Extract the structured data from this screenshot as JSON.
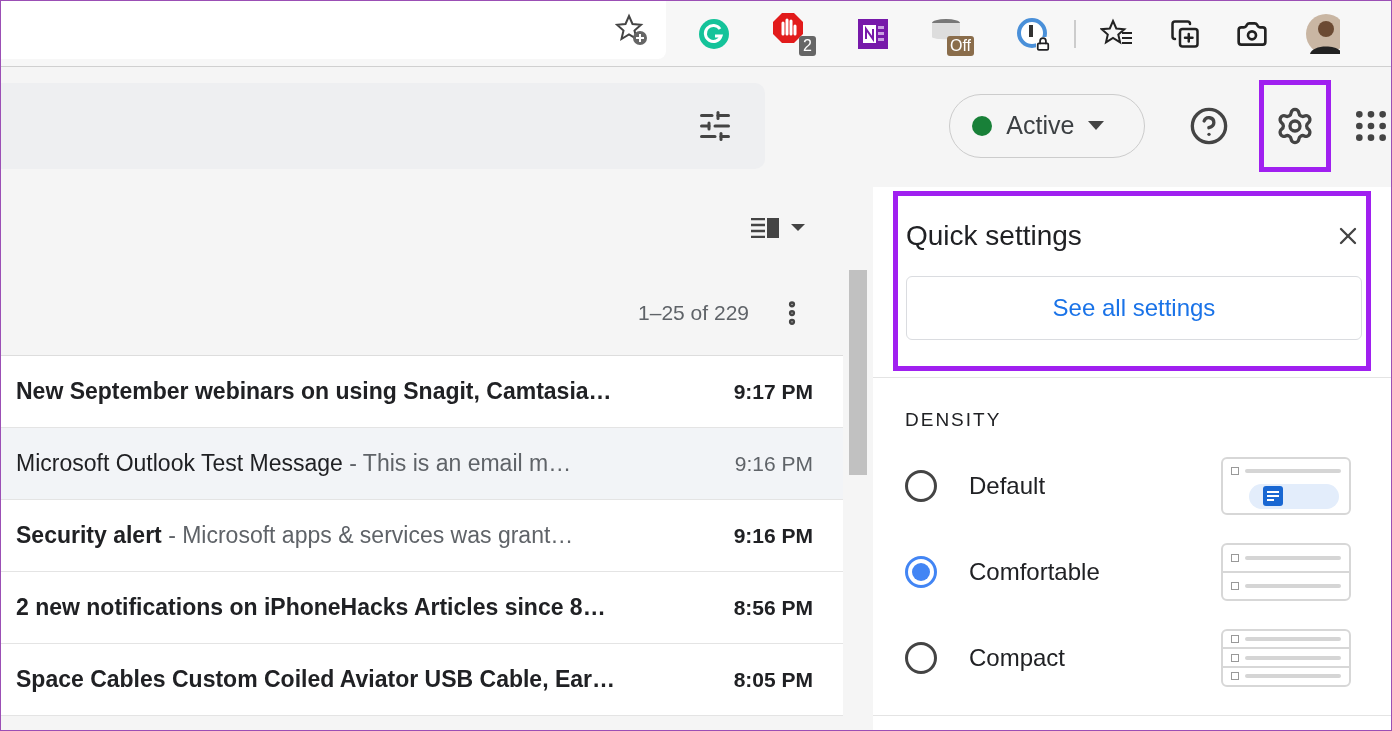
{
  "browser_toolbar": {
    "extensions": [
      {
        "kind": "add-favorite"
      },
      {
        "kind": "grammar"
      },
      {
        "kind": "blocker",
        "badge": "2"
      },
      {
        "kind": "notebook"
      },
      {
        "kind": "toggle",
        "badge": "Off"
      },
      {
        "kind": "lock"
      },
      {
        "kind": "favorites"
      },
      {
        "kind": "collections"
      },
      {
        "kind": "capture"
      },
      {
        "kind": "avatar"
      }
    ]
  },
  "header": {
    "status": {
      "label": "Active",
      "color": "#188038"
    },
    "settings_highlighted": true
  },
  "mail_list": {
    "pagination": "1–25 of 229",
    "rows": [
      {
        "subject": "New September webinars on using Snagit, Camtasia…",
        "time": "9:17 PM",
        "unread": true,
        "hovered": false
      },
      {
        "subject": "Microsoft Outlook Test Message",
        "snippet": " - This is an email m…",
        "time": "9:16 PM",
        "unread": false,
        "hovered": true
      },
      {
        "subject": "Security alert",
        "snippet": " - Microsoft apps & services was grant…",
        "time": "9:16 PM",
        "unread": true,
        "hovered": false
      },
      {
        "subject": "2 new notifications on iPhoneHacks Articles since 8…",
        "time": "8:56 PM",
        "unread": true,
        "hovered": false
      },
      {
        "subject": "Space Cables Custom Coiled Aviator USB Cable, Ear…",
        "time": "8:05 PM",
        "unread": true,
        "hovered": false
      }
    ]
  },
  "quick_settings": {
    "title": "Quick settings",
    "button": "See all settings",
    "highlighted": true,
    "section": "DENSITY",
    "options": [
      {
        "label": "Default",
        "selected": false,
        "kind": "default"
      },
      {
        "label": "Comfortable",
        "selected": true,
        "kind": "comfortable"
      },
      {
        "label": "Compact",
        "selected": false,
        "kind": "compact"
      }
    ]
  }
}
